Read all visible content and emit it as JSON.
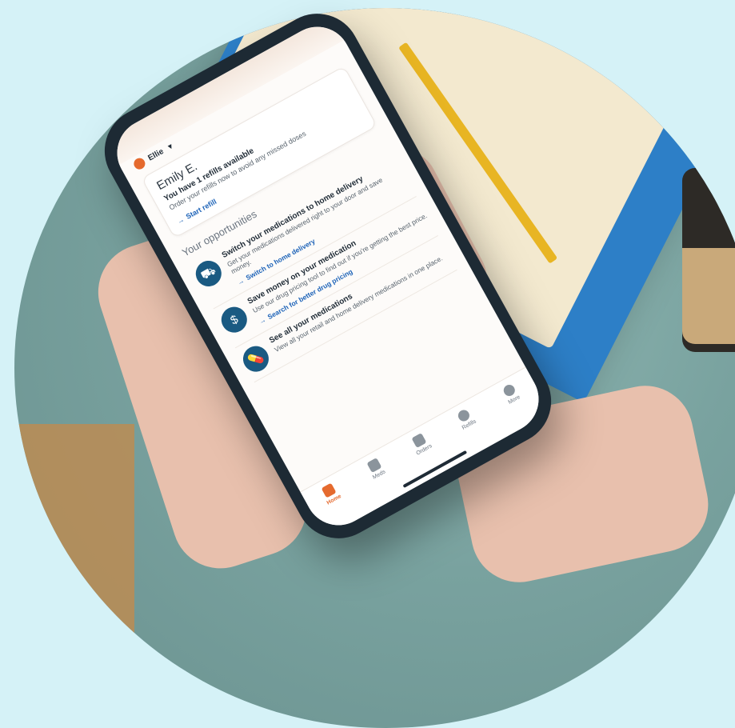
{
  "colors": {
    "page_background": "#d5f2f7",
    "brand_orange": "#e56a2e",
    "icon_blue": "#1a5a82",
    "link_blue": "#1d63b8"
  },
  "app": {
    "profile_selector": "Ellie",
    "greeting": "Emily E.",
    "refill_card": {
      "title": "You have 1 refills available",
      "text": "Order your refills now to avoid any missed doses",
      "link": "Start refill"
    },
    "section_title": "Your opportunities",
    "opportunities": [
      {
        "icon": "delivery-truck-icon",
        "title": "Switch your medications to home delivery",
        "text": "Get your medications delivered right to your door and save money.",
        "link": "Switch to home delivery"
      },
      {
        "icon": "price-search-icon",
        "title": "Save money on your medication",
        "text": "Use our drug pricing tool to find out if you're getting the best price.",
        "link": "Search for better drug pricing"
      },
      {
        "icon": "pill-icon",
        "title": "See all your medications",
        "text": "View all your retail and home delivery medications in one place.",
        "link": ""
      }
    ],
    "tabs": [
      {
        "label": "Home",
        "icon": "home-icon",
        "active": true
      },
      {
        "label": "Meds",
        "icon": "pills-icon",
        "active": false
      },
      {
        "label": "Orders",
        "icon": "box-icon",
        "active": false
      },
      {
        "label": "Refills",
        "icon": "plus-circle-icon",
        "active": false
      },
      {
        "label": "More",
        "icon": "more-dots-icon",
        "active": false
      }
    ]
  }
}
